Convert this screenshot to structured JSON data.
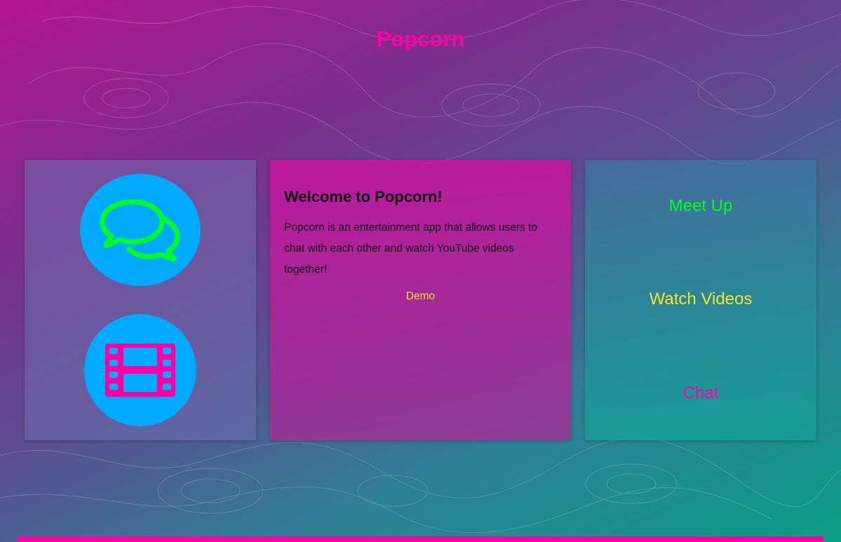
{
  "header": {
    "title": "Popcorn"
  },
  "features": {
    "chat_icon": "chat-bubbles-icon",
    "video_icon": "film-strip-icon"
  },
  "welcome": {
    "heading": "Welcome to Popcorn!",
    "description": "Popcorn is an entertainment app that allows users to chat with each other and watch YouTube videos together!",
    "demo_label": "Demo"
  },
  "nav": {
    "items": [
      {
        "label": "Meet Up"
      },
      {
        "label": "Watch Videos"
      },
      {
        "label": "Chat"
      }
    ]
  },
  "colors": {
    "brand_pink": "#ff00a8",
    "chat_green": "#00ff1e",
    "accent_yellow": "#f5e625",
    "circle_blue": "#00aaff",
    "footer": "#ff00a8"
  }
}
